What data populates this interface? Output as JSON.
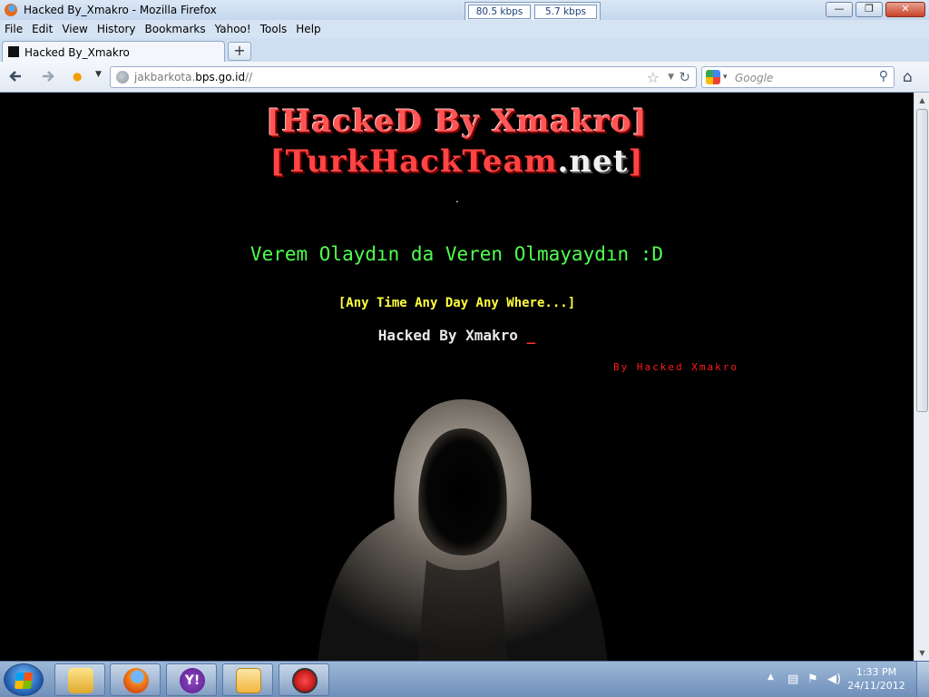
{
  "window": {
    "title": "Hacked By_Xmakro - Mozilla Firefox",
    "net_down": "80.5 kbps",
    "net_up": "5.7 kbps",
    "min": "—",
    "max": "❐",
    "close": "✕"
  },
  "menu": [
    "File",
    "Edit",
    "View",
    "History",
    "Bookmarks",
    "Yahoo!",
    "Tools",
    "Help"
  ],
  "tab": {
    "label": "Hacked By_Xmakro",
    "new_tab": "+"
  },
  "nav": {
    "url_host": "jakbarkota.",
    "url_domain": "bps.go.id",
    "url_path": "//",
    "search_placeholder": "Google"
  },
  "page": {
    "headline1": "[HackeD By Xmakro]",
    "headline2_a": "[Turk",
    "headline2_b": "HackTeam",
    "headline2_c": ".net",
    "headline2_d": "]",
    "dot": ".",
    "verem": "Verem Olaydın da Veren Olmayaydın :D",
    "anytime": "[Any Time Any Day Any Where...]",
    "hacked": "Hacked By Xmakro",
    "cursor": "_",
    "byline": "By Hacked Xmakro"
  },
  "taskbar": {
    "time": "1:33 PM",
    "date": "24/11/2012",
    "yahoo_glyph": "Y!"
  },
  "icons": {
    "colors": {
      "accent_red": "#ff4444",
      "green": "#50ff50",
      "yellow": "#ffff40"
    }
  }
}
